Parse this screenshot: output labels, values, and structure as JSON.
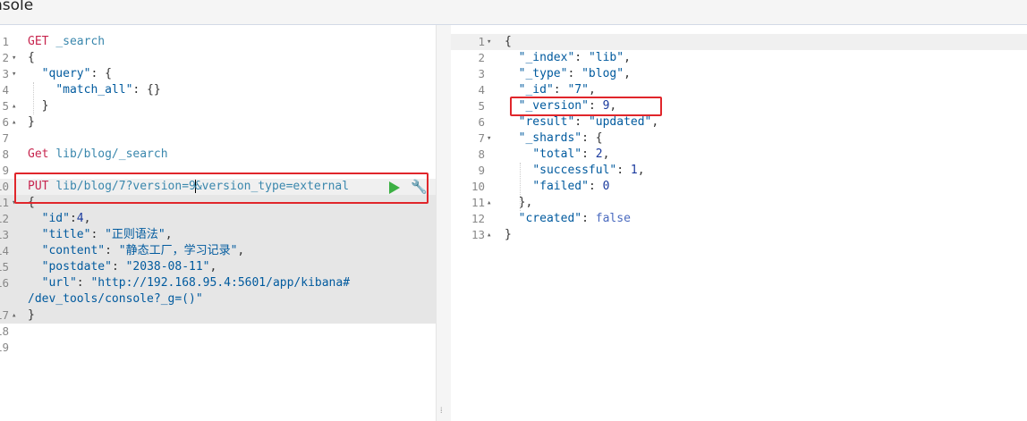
{
  "app": {
    "title_partial": "nsole"
  },
  "request": {
    "lines": [
      {
        "n": "1",
        "fold": "",
        "segs": [
          {
            "t": "GET ",
            "c": "m"
          },
          {
            "t": "_search",
            "c": "p"
          }
        ]
      },
      {
        "n": "2",
        "fold": "▾",
        "segs": [
          {
            "t": "{",
            "c": ""
          }
        ]
      },
      {
        "n": "3",
        "fold": "▾",
        "segs": [
          {
            "t": "  ",
            "c": ""
          },
          {
            "t": "\"query\"",
            "c": "k"
          },
          {
            "t": ": {",
            "c": ""
          }
        ]
      },
      {
        "n": "4",
        "fold": "",
        "segs": [
          {
            "t": "    ",
            "c": ""
          },
          {
            "t": "\"match_all\"",
            "c": "k"
          },
          {
            "t": ": {}",
            "c": ""
          }
        ]
      },
      {
        "n": "5",
        "fold": "▴",
        "segs": [
          {
            "t": "  }",
            "c": ""
          }
        ]
      },
      {
        "n": "6",
        "fold": "▴",
        "segs": [
          {
            "t": "}",
            "c": ""
          }
        ]
      },
      {
        "n": "7",
        "fold": "",
        "segs": []
      },
      {
        "n": "8",
        "fold": "",
        "segs": [
          {
            "t": "Get ",
            "c": "m"
          },
          {
            "t": "lib/blog/_search",
            "c": "p"
          }
        ]
      },
      {
        "n": "9",
        "fold": "",
        "segs": []
      },
      {
        "n": "10",
        "fold": "",
        "segs": [
          {
            "t": "PUT ",
            "c": "m"
          },
          {
            "t": "lib/blog/7?version=9",
            "c": "p"
          },
          {
            "t": "",
            "c": "cursor"
          },
          {
            "t": "&version_type=external",
            "c": "p"
          }
        ]
      },
      {
        "n": "11",
        "fold": "▾",
        "segs": [
          {
            "t": "{",
            "c": ""
          }
        ]
      },
      {
        "n": "12",
        "fold": "",
        "segs": [
          {
            "t": "  ",
            "c": ""
          },
          {
            "t": "\"id\"",
            "c": "k"
          },
          {
            "t": ":",
            "c": ""
          },
          {
            "t": "4",
            "c": "n"
          },
          {
            "t": ",",
            "c": ""
          }
        ]
      },
      {
        "n": "13",
        "fold": "",
        "segs": [
          {
            "t": "  ",
            "c": ""
          },
          {
            "t": "\"title\"",
            "c": "k"
          },
          {
            "t": ": ",
            "c": ""
          },
          {
            "t": "\"正则语法\"",
            "c": "s"
          },
          {
            "t": ",",
            "c": ""
          }
        ]
      },
      {
        "n": "14",
        "fold": "",
        "segs": [
          {
            "t": "  ",
            "c": ""
          },
          {
            "t": "\"content\"",
            "c": "k"
          },
          {
            "t": ": ",
            "c": ""
          },
          {
            "t": "\"静态工厂，学习记录\"",
            "c": "s"
          },
          {
            "t": ",",
            "c": ""
          }
        ]
      },
      {
        "n": "15",
        "fold": "",
        "segs": [
          {
            "t": "  ",
            "c": ""
          },
          {
            "t": "\"postdate\"",
            "c": "k"
          },
          {
            "t": ": ",
            "c": ""
          },
          {
            "t": "\"2038-08-11\"",
            "c": "s"
          },
          {
            "t": ",",
            "c": ""
          }
        ]
      },
      {
        "n": "16",
        "fold": "",
        "segs": [
          {
            "t": "  ",
            "c": ""
          },
          {
            "t": "\"url\"",
            "c": "k"
          },
          {
            "t": ": ",
            "c": ""
          },
          {
            "t": "\"http://192.168.95.4:5601/app/kibana#",
            "c": "s"
          }
        ]
      },
      {
        "n": "",
        "fold": "",
        "segs": [
          {
            "t": "/dev_tools/console?_g=()\"",
            "c": "s"
          }
        ]
      },
      {
        "n": "17",
        "fold": "▴",
        "segs": [
          {
            "t": "}",
            "c": ""
          }
        ]
      },
      {
        "n": "18",
        "fold": "",
        "segs": []
      },
      {
        "n": "19",
        "fold": "",
        "segs": []
      }
    ]
  },
  "response": {
    "lines": [
      {
        "n": "1",
        "fold": "▾",
        "segs": [
          {
            "t": "{",
            "c": ""
          }
        ]
      },
      {
        "n": "2",
        "fold": "",
        "segs": [
          {
            "t": "  ",
            "c": ""
          },
          {
            "t": "\"_index\"",
            "c": "k"
          },
          {
            "t": ": ",
            "c": ""
          },
          {
            "t": "\"lib\"",
            "c": "s"
          },
          {
            "t": ",",
            "c": ""
          }
        ]
      },
      {
        "n": "3",
        "fold": "",
        "segs": [
          {
            "t": "  ",
            "c": ""
          },
          {
            "t": "\"_type\"",
            "c": "k"
          },
          {
            "t": ": ",
            "c": ""
          },
          {
            "t": "\"blog\"",
            "c": "s"
          },
          {
            "t": ",",
            "c": ""
          }
        ]
      },
      {
        "n": "4",
        "fold": "",
        "segs": [
          {
            "t": "  ",
            "c": ""
          },
          {
            "t": "\"_id\"",
            "c": "k"
          },
          {
            "t": ": ",
            "c": ""
          },
          {
            "t": "\"7\"",
            "c": "s"
          },
          {
            "t": ",",
            "c": ""
          }
        ]
      },
      {
        "n": "5",
        "fold": "",
        "segs": [
          {
            "t": "  ",
            "c": ""
          },
          {
            "t": "\"_version\"",
            "c": "k"
          },
          {
            "t": ": ",
            "c": ""
          },
          {
            "t": "9",
            "c": "n"
          },
          {
            "t": ",",
            "c": ""
          }
        ]
      },
      {
        "n": "6",
        "fold": "",
        "segs": [
          {
            "t": "  ",
            "c": ""
          },
          {
            "t": "\"result\"",
            "c": "k"
          },
          {
            "t": ": ",
            "c": ""
          },
          {
            "t": "\"updated\"",
            "c": "s"
          },
          {
            "t": ",",
            "c": ""
          }
        ]
      },
      {
        "n": "7",
        "fold": "▾",
        "segs": [
          {
            "t": "  ",
            "c": ""
          },
          {
            "t": "\"_shards\"",
            "c": "k"
          },
          {
            "t": ": {",
            "c": ""
          }
        ]
      },
      {
        "n": "8",
        "fold": "",
        "segs": [
          {
            "t": "    ",
            "c": ""
          },
          {
            "t": "\"total\"",
            "c": "k"
          },
          {
            "t": ": ",
            "c": ""
          },
          {
            "t": "2",
            "c": "n"
          },
          {
            "t": ",",
            "c": ""
          }
        ]
      },
      {
        "n": "9",
        "fold": "",
        "segs": [
          {
            "t": "    ",
            "c": ""
          },
          {
            "t": "\"successful\"",
            "c": "k"
          },
          {
            "t": ": ",
            "c": ""
          },
          {
            "t": "1",
            "c": "n"
          },
          {
            "t": ",",
            "c": ""
          }
        ]
      },
      {
        "n": "10",
        "fold": "",
        "segs": [
          {
            "t": "    ",
            "c": ""
          },
          {
            "t": "\"failed\"",
            "c": "k"
          },
          {
            "t": ": ",
            "c": ""
          },
          {
            "t": "0",
            "c": "n"
          }
        ]
      },
      {
        "n": "11",
        "fold": "▴",
        "segs": [
          {
            "t": "  },",
            "c": ""
          }
        ]
      },
      {
        "n": "12",
        "fold": "",
        "segs": [
          {
            "t": "  ",
            "c": ""
          },
          {
            "t": "\"created\"",
            "c": "k"
          },
          {
            "t": ": ",
            "c": ""
          },
          {
            "t": "false",
            "c": "b"
          }
        ]
      },
      {
        "n": "13",
        "fold": "▴",
        "segs": [
          {
            "t": "}",
            "c": ""
          }
        ]
      }
    ]
  },
  "actions": {
    "run_icon": "play-icon",
    "settings_icon": "wrench-icon"
  },
  "colors": {
    "highlight_box": "#e0262b",
    "run_button": "#3cb043"
  }
}
